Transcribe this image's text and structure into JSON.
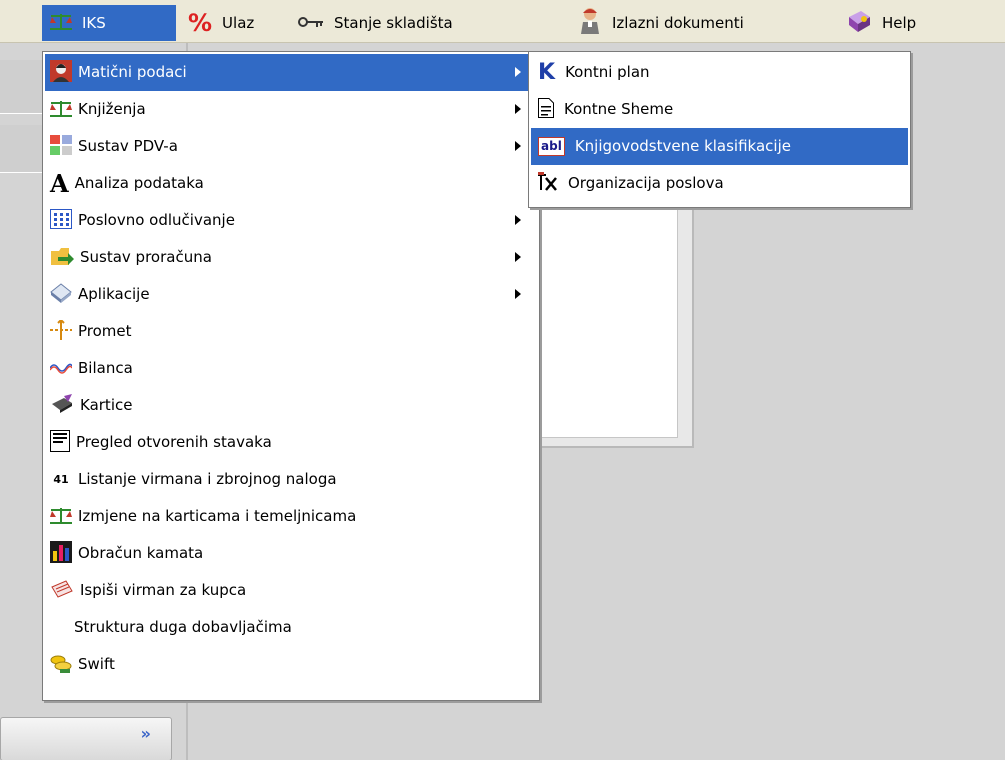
{
  "menubar": {
    "items": [
      {
        "label": "IKS",
        "icon": "scale-icon"
      },
      {
        "label": "Ulaz",
        "icon": "percent-icon"
      },
      {
        "label": "Stanje skladišta",
        "icon": "key-icon"
      },
      {
        "label": "Izlazni dokumenti",
        "icon": "person-icon"
      },
      {
        "label": "Help",
        "icon": "help-book-icon"
      }
    ]
  },
  "main_menu": {
    "items": [
      {
        "label": "Matični podaci",
        "icon": "avatar-icon",
        "submenu": true
      },
      {
        "label": "Knjiženja",
        "icon": "scale-icon",
        "submenu": true
      },
      {
        "label": "Sustav PDV-a",
        "icon": "tax-grid-icon",
        "submenu": true
      },
      {
        "label": "Analiza podataka",
        "icon": "letter-a-icon",
        "submenu": false
      },
      {
        "label": "Poslovno odlučivanje",
        "icon": "dots-grid-icon",
        "submenu": true
      },
      {
        "label": "Sustav proračuna",
        "icon": "folder-arrow-icon",
        "submenu": true
      },
      {
        "label": "Aplikacije",
        "icon": "house-icon",
        "submenu": true
      },
      {
        "label": "Promet",
        "icon": "arrows-icon",
        "submenu": false
      },
      {
        "label": "Bilanca",
        "icon": "wave-icon",
        "submenu": false
      },
      {
        "label": "Kartice",
        "icon": "card-icon",
        "submenu": false
      },
      {
        "label": "Pregled otvorenih stavaka",
        "icon": "list-doc-icon",
        "submenu": false
      },
      {
        "label": "Listanje virmana i zbrojnog naloga",
        "icon": "number-41-icon",
        "icon_text": "41",
        "submenu": false
      },
      {
        "label": "Izmjene na karticama i temeljnicama",
        "icon": "scale-icon",
        "submenu": false
      },
      {
        "label": "Obračun kamata",
        "icon": "bar-chart-icon",
        "submenu": false
      },
      {
        "label": "Ispiši virman za kupca",
        "icon": "pen-doc-icon",
        "submenu": false
      },
      {
        "label": "Struktura duga dobavljačima",
        "icon": "",
        "submenu": false
      },
      {
        "label": "Swift",
        "icon": "coins-icon",
        "submenu": false
      }
    ]
  },
  "sub_menu": {
    "items": [
      {
        "label": "Kontni plan",
        "icon": "letter-k-icon",
        "icon_text": "K"
      },
      {
        "label": "Kontne Sheme",
        "icon": "document-icon"
      },
      {
        "label": "Knjigovodstvene klasifikacije",
        "icon": "abl-icon",
        "icon_text": "abl"
      },
      {
        "label": "Organizacija poslova",
        "icon": "tx-icon"
      }
    ]
  },
  "colors": {
    "highlight": "#316ac5",
    "menubar_bg": "#ece9d8",
    "desktop_bg": "#d4d4d4"
  }
}
